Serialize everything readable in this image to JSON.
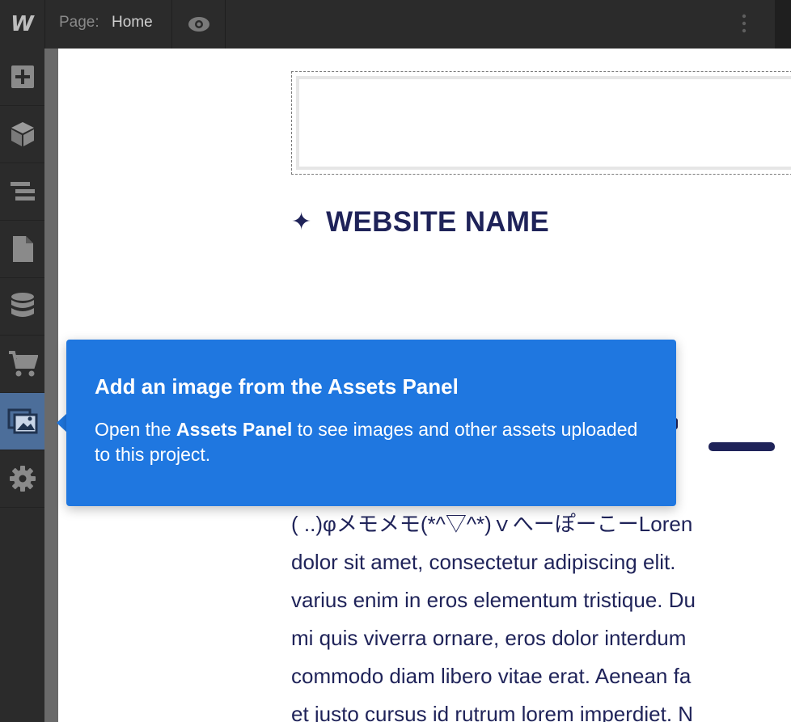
{
  "topbar": {
    "logo": "W",
    "page_label": "Page:",
    "page_name": "Home",
    "preview_icon": "eye-icon",
    "more_icon": "more-vertical-icon"
  },
  "sidebar": {
    "items": [
      {
        "name": "add",
        "icon": "plus-square-icon"
      },
      {
        "name": "symbols",
        "icon": "cube-icon"
      },
      {
        "name": "navigator",
        "icon": "layers-icon"
      },
      {
        "name": "pages",
        "icon": "file-icon"
      },
      {
        "name": "cms",
        "icon": "database-icon"
      },
      {
        "name": "ecommerce",
        "icon": "cart-icon"
      },
      {
        "name": "assets",
        "icon": "images-icon",
        "active": true
      },
      {
        "name": "settings",
        "icon": "gear-icon"
      }
    ]
  },
  "canvas": {
    "site_star": "✦",
    "site_name": "WEBSITE NAME",
    "body_lines": [
      "( ..)φメモメモ(*^▽^*)ｖへーぽーこーLoren",
      "dolor sit amet, consectetur adipiscing elit.",
      "varius enim in eros elementum tristique. Du",
      "mi quis viverra ornare, eros dolor interdum",
      "commodo diam libero vitae erat. Aenean fa",
      "et justo cursus id rutrum lorem imperdiet. N"
    ]
  },
  "tooltip": {
    "title": "Add an image from the Assets Panel",
    "body_before": "Open the ",
    "body_bold": "Assets Panel",
    "body_after": " to see images and other assets uploaded to this project."
  },
  "colors": {
    "topbar_bg": "#2b2b2b",
    "sidebar_active": "#4c6e9a",
    "tooltip_bg": "#1f77e0",
    "site_text": "#1f2359"
  }
}
